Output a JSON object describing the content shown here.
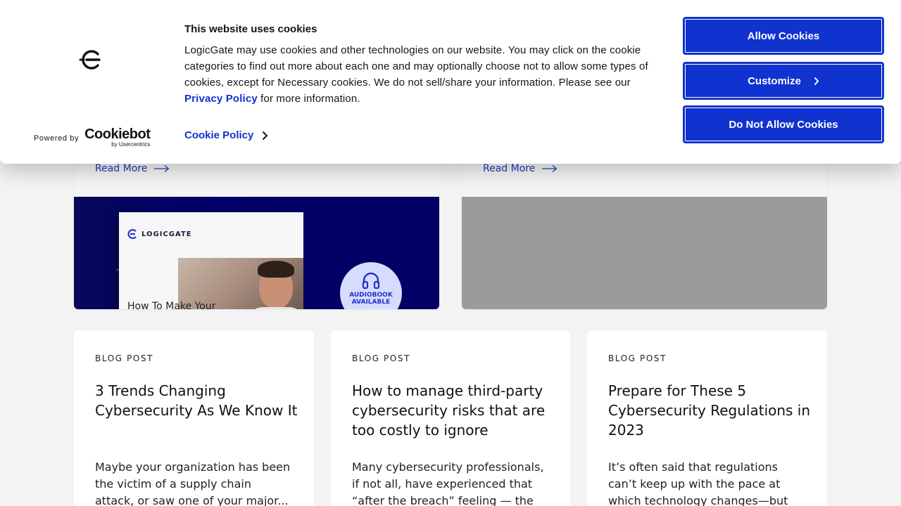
{
  "featured": [
    {
      "read_more": "Read More"
    },
    {
      "read_more": "Read More"
    }
  ],
  "ebook": {
    "brand": "LOGICGATE",
    "title": "How To Make Your",
    "badge_line1": "AUDIOBOOK",
    "badge_line2": "AVAILABLE"
  },
  "posts": [
    {
      "label": "BLOG POST",
      "title": "3 Trends Changing Cybersecurity As We Know It",
      "excerpt": "Maybe your organization has been the victim of a supply chain attack, or saw one of your major..."
    },
    {
      "label": "BLOG POST",
      "title": "How to manage third-party cybersecurity risks that are too costly to ignore",
      "excerpt": "Many cybersecurity professionals, if not all, have experienced that “after the breach” feeling — the moment"
    },
    {
      "label": "BLOG POST",
      "title": "Prepare for These 5 Cybersecurity Regulations in 2023",
      "excerpt": "It’s often said that regulations can’t keep up with the pace at which technology changes—but that"
    }
  ],
  "cookie_banner": {
    "heading": "This website uses cookies",
    "body_before_link": "LogicGate may use cookies and other technologies on our website. You may click on the cookie categories to find out more about each one and may optionally choose not to allow some types of cookies, except for Necessary cookies.  We do not sell/share your information. Please see our ",
    "privacy_link": "Privacy Policy",
    "body_after_link": " for more information.",
    "cookie_policy_link": "Cookie Policy",
    "powered_by": "Powered by",
    "cookiebot_name": "Cookiebot",
    "cookiebot_sub": "by Usercentrics",
    "buttons": {
      "allow": "Allow Cookies",
      "customize": "Customize",
      "deny": "Do Not Allow Cookies"
    }
  },
  "colors": {
    "accent_blue": "#1032cf",
    "link_blue": "#1f3fbd",
    "navy": "#00006a"
  }
}
